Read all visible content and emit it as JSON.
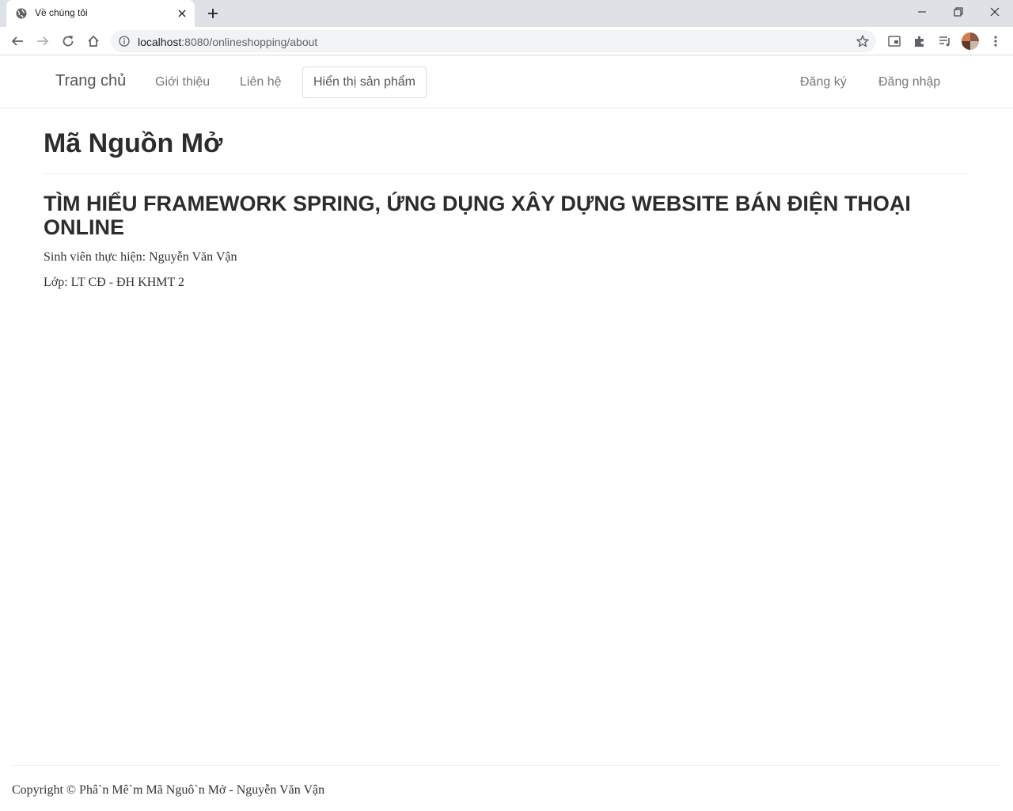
{
  "browser": {
    "tab_title": "Về chúng tôi",
    "url_host": "localhost",
    "url_path": ":8080/onlineshopping/about"
  },
  "navbar": {
    "brand": "Trang chủ",
    "links": {
      "about": "Giới thiệu",
      "contact": "Liên hệ",
      "products": "Hiển thị sản phẩm",
      "register": "Đăng ký",
      "login": "Đăng nhập"
    }
  },
  "main": {
    "page_title": "Mã Nguồn Mở",
    "section_title": "TÌM HIỂU FRAMEWORK SPRING, ỨNG DỤNG XÂY DỰNG WEBSITE BÁN ĐIỆN THOẠI ONLINE",
    "student_line": "Sinh viên thực hiện: Nguyễn Văn Vận",
    "class_line": "Lớp: LT CĐ - ĐH KHMT 2"
  },
  "footer": {
    "copyright": "Copyright © Phâ`n Mê`m Mã Nguô`n Mở - Nguyễn Văn Vận"
  }
}
